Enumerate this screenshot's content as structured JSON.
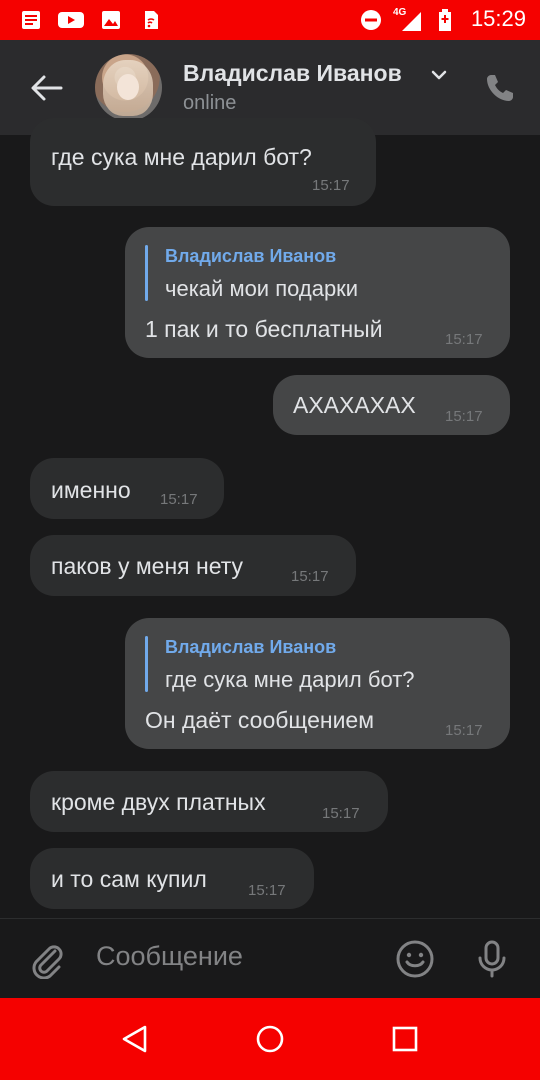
{
  "status_bar": {
    "time": "15:29",
    "network_label": "4G",
    "colors": {
      "background": "#f50100"
    },
    "icons": [
      "notes-icon",
      "youtube-icon",
      "gallery-icon",
      "sim-icon",
      "dnd-icon",
      "signal-icon",
      "battery-icon"
    ]
  },
  "header": {
    "contact_name": "Владислав Иванов",
    "status": "online",
    "icons": [
      "back-arrow-icon",
      "chevron-down-icon",
      "phone-icon"
    ]
  },
  "messages": [
    {
      "direction": "in",
      "text": "где сука мне дарил бот?",
      "time": "15:17"
    },
    {
      "direction": "out",
      "reply_to": {
        "author": "Владислав Иванов",
        "text": "чекай мои подарки"
      },
      "text": "1 пак и то бесплатный",
      "time": "15:17"
    },
    {
      "direction": "out",
      "text": "АХАХАХАХ",
      "time": "15:17"
    },
    {
      "direction": "in",
      "text": "именно",
      "time": "15:17"
    },
    {
      "direction": "in",
      "text": "паков у меня нету",
      "time": "15:17"
    },
    {
      "direction": "out",
      "reply_to": {
        "author": "Владислав Иванов",
        "text": "где сука мне дарил бот?"
      },
      "text": "Он даёт сообщением",
      "time": "15:17"
    },
    {
      "direction": "in",
      "text": "кроме двух платных",
      "time": "15:17"
    },
    {
      "direction": "in",
      "text": "и то сам купил",
      "time": "15:17"
    }
  ],
  "composer": {
    "placeholder": "Сообщение",
    "icons": [
      "attach-icon",
      "emoji-icon",
      "microphone-icon"
    ]
  },
  "nav_bar": {
    "icons": [
      "nav-back-icon",
      "nav-home-icon",
      "nav-recents-icon"
    ]
  },
  "colors": {
    "accent": "#71aaeb",
    "incoming_bubble": "#2c2d2e",
    "outgoing_bubble": "#454647",
    "background": "#19191a"
  }
}
